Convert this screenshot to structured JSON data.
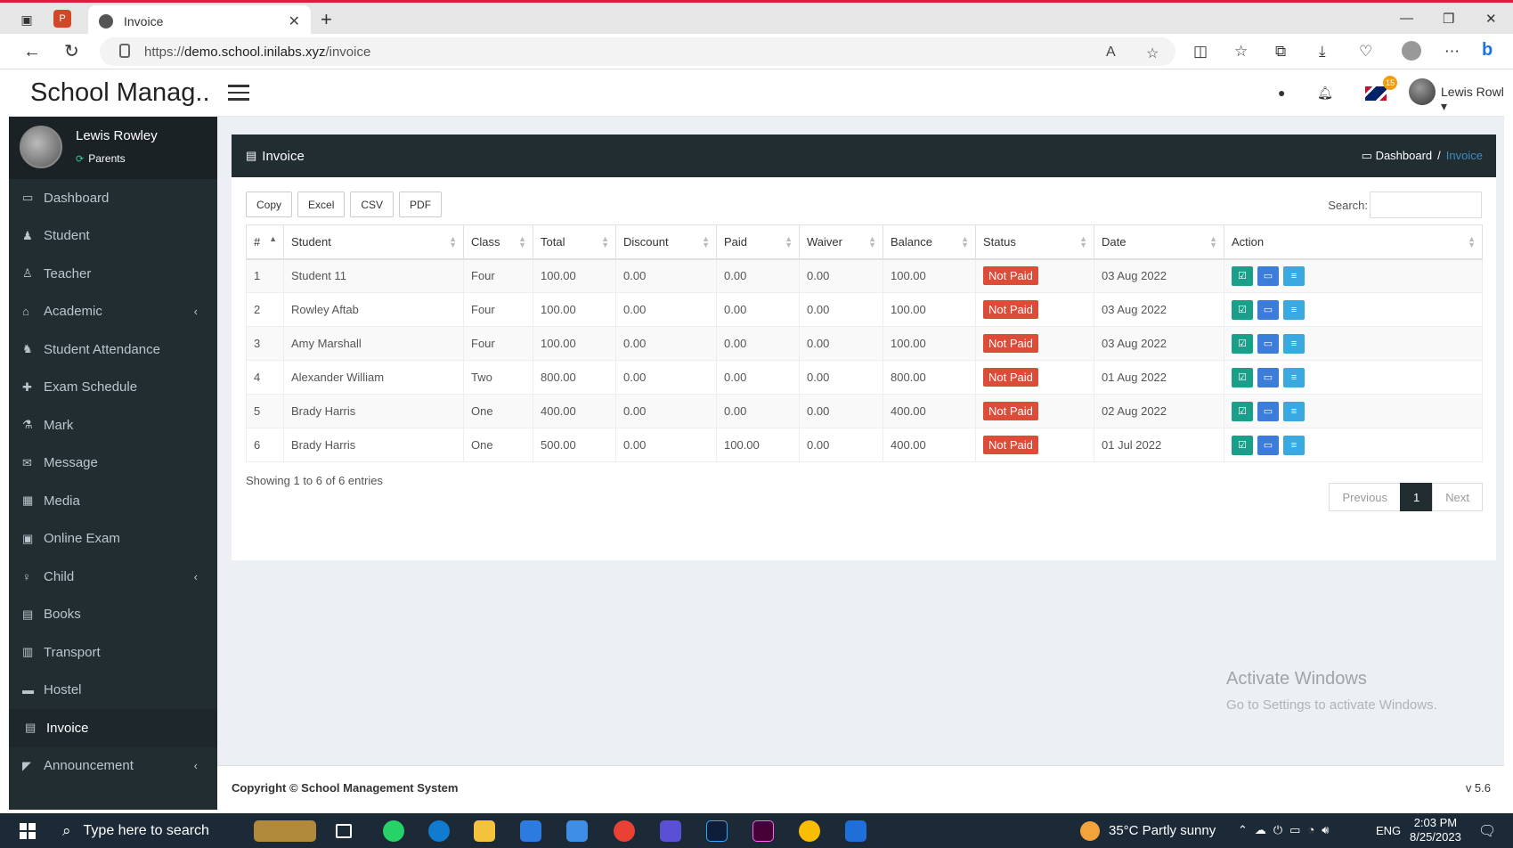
{
  "browser": {
    "tab_title": "Invoice",
    "url_prefix": "https://",
    "url_host": "demo.school.inilabs.xyz",
    "url_path": "/invoice"
  },
  "header": {
    "brand": "School Manag..",
    "flag_badge": "15",
    "user_name": "Lewis Rowl",
    "caret": "▾"
  },
  "sidebar": {
    "user_name": "Lewis Rowley",
    "user_role": "Parents",
    "items": [
      {
        "label": "Dashboard",
        "icon": "laptop-icon"
      },
      {
        "label": "Student",
        "icon": "student-icon"
      },
      {
        "label": "Teacher",
        "icon": "teacher-icon"
      },
      {
        "label": "Academic",
        "icon": "academic-icon",
        "has_children": true
      },
      {
        "label": "Student Attendance",
        "icon": "attendance-icon"
      },
      {
        "label": "Exam Schedule",
        "icon": "puzzle-icon"
      },
      {
        "label": "Mark",
        "icon": "flask-icon"
      },
      {
        "label": "Message",
        "icon": "envelope-icon"
      },
      {
        "label": "Media",
        "icon": "film-icon"
      },
      {
        "label": "Online Exam",
        "icon": "desktop-icon"
      },
      {
        "label": "Child",
        "icon": "child-icon",
        "has_children": true
      },
      {
        "label": "Books",
        "icon": "book-icon"
      },
      {
        "label": "Transport",
        "icon": "bus-icon"
      },
      {
        "label": "Hostel",
        "icon": "bed-icon"
      },
      {
        "label": "Invoice",
        "icon": "file-icon",
        "active": true
      },
      {
        "label": "Announcement",
        "icon": "bullhorn-icon",
        "has_children": true
      }
    ]
  },
  "page": {
    "title": "Invoice",
    "breadcrumb_home": "Dashboard",
    "breadcrumb_sep": "/",
    "breadcrumb_current": "Invoice",
    "export_buttons": [
      "Copy",
      "Excel",
      "CSV",
      "PDF"
    ],
    "search_label": "Search:",
    "search_value": ""
  },
  "table": {
    "headers": [
      "#",
      "Student",
      "Class",
      "Total",
      "Discount",
      "Paid",
      "Waiver",
      "Balance",
      "Status",
      "Date",
      "Action"
    ],
    "rows": [
      [
        "1",
        "Student 11",
        "Four",
        "100.00",
        "0.00",
        "0.00",
        "0.00",
        "100.00",
        "Not Paid",
        "03 Aug 2022"
      ],
      [
        "2",
        "Rowley Aftab",
        "Four",
        "100.00",
        "0.00",
        "0.00",
        "0.00",
        "100.00",
        "Not Paid",
        "03 Aug 2022"
      ],
      [
        "3",
        "Amy Marshall",
        "Four",
        "100.00",
        "0.00",
        "0.00",
        "0.00",
        "100.00",
        "Not Paid",
        "03 Aug 2022"
      ],
      [
        "4",
        "Alexander William",
        "Two",
        "800.00",
        "0.00",
        "0.00",
        "0.00",
        "800.00",
        "Not Paid",
        "01 Aug 2022"
      ],
      [
        "5",
        "Brady Harris",
        "One",
        "400.00",
        "0.00",
        "0.00",
        "0.00",
        "400.00",
        "Not Paid",
        "02 Aug 2022"
      ],
      [
        "6",
        "Brady Harris",
        "One",
        "500.00",
        "0.00",
        "100.00",
        "0.00",
        "400.00",
        "Not Paid",
        "01 Jul 2022"
      ]
    ],
    "showing": "Showing 1 to 6 of 6 entries"
  },
  "pagination": {
    "previous": "Previous",
    "current": "1",
    "next": "Next"
  },
  "watermark": {
    "line1": "Activate Windows",
    "line2": "Go to Settings to activate Windows."
  },
  "footer": {
    "copyright": "Copyright © School Management System",
    "version": "v 5.6"
  },
  "taskbar": {
    "search_placeholder": "Type here to search",
    "weather": "35°C  Partly sunny",
    "lang": "ENG",
    "time": "2:03 PM",
    "date": "8/25/2023"
  },
  "colors": {
    "sidebar": "#222d32",
    "danger": "#dd4b39",
    "accent": "#3c8dbc"
  }
}
